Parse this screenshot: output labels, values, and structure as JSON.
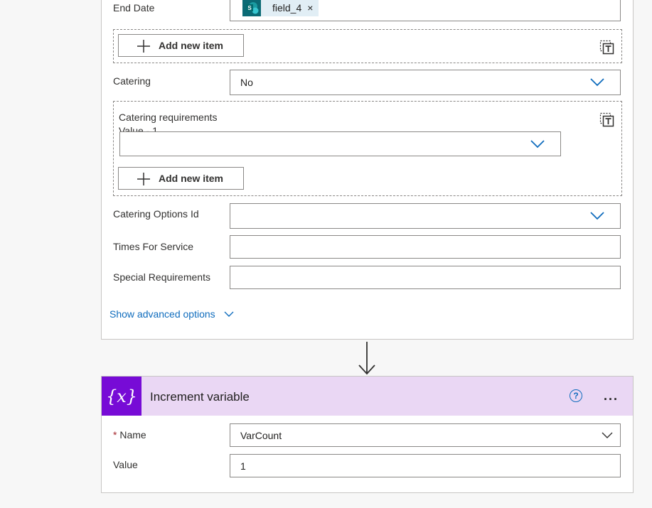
{
  "form": {
    "end_date_label": "End Date",
    "end_date_token": "field_4",
    "end_date_token_remove": "×",
    "add_item_label": "Add new item",
    "catering_label": "Catering",
    "catering_value": "No",
    "catering_req_label": "Catering requirements",
    "catering_req_sublabel": "Value - 1",
    "catering_req_value": "",
    "catering_options_label": "Catering Options Id",
    "catering_options_value": "",
    "times_label": "Times For Service",
    "times_value": "",
    "special_label": "Special Requirements",
    "special_value": "",
    "advanced_link": "Show advanced options"
  },
  "increment": {
    "title": "Increment variable",
    "icon_text": "{x}",
    "help": "?",
    "more": "...",
    "name_required": "*",
    "name_label": "Name",
    "name_value": "VarCount",
    "value_label": "Value",
    "value_value": "1"
  },
  "colors": {
    "accent": "#0f6cbd",
    "variable_header": "#ead7f4",
    "variable_icon": "#770bd6",
    "sharepoint": "#0b6a75"
  }
}
